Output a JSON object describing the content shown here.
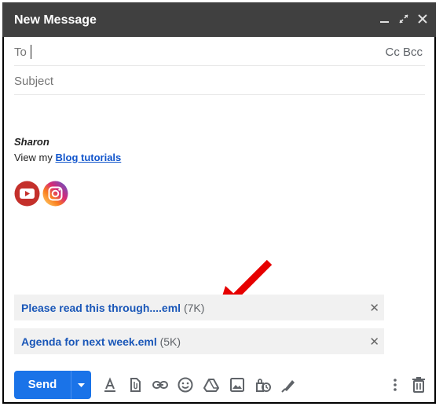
{
  "window": {
    "title": "New Message",
    "controls": [
      "minimize-icon",
      "expand-icon",
      "close-icon"
    ]
  },
  "to": {
    "label": "To",
    "value": "",
    "cc_bcc": "Cc Bcc"
  },
  "subject": {
    "placeholder": "Subject",
    "value": ""
  },
  "signature": {
    "name": "Sharon",
    "line_prefix": "View my ",
    "link_text": "Blog tutorials",
    "social_icons": [
      "youtube-icon",
      "instagram-icon"
    ]
  },
  "attachments": [
    {
      "name": "Please read this through....eml",
      "size": "(7K)"
    },
    {
      "name": "Agenda for next week.eml",
      "size": "(5K)"
    }
  ],
  "toolbar": {
    "send_label": "Send",
    "icons": [
      "formatting-icon",
      "attach-file-icon",
      "insert-link-icon",
      "emoji-icon",
      "drive-icon",
      "insert-photo-icon",
      "confidential-mode-icon",
      "signature-icon",
      "more-options-icon",
      "discard-draft-icon"
    ]
  },
  "colors": {
    "title_bar": "#404040",
    "send_button": "#1a73e8",
    "link": "#1155cc",
    "annotation_arrow": "#e60000"
  }
}
